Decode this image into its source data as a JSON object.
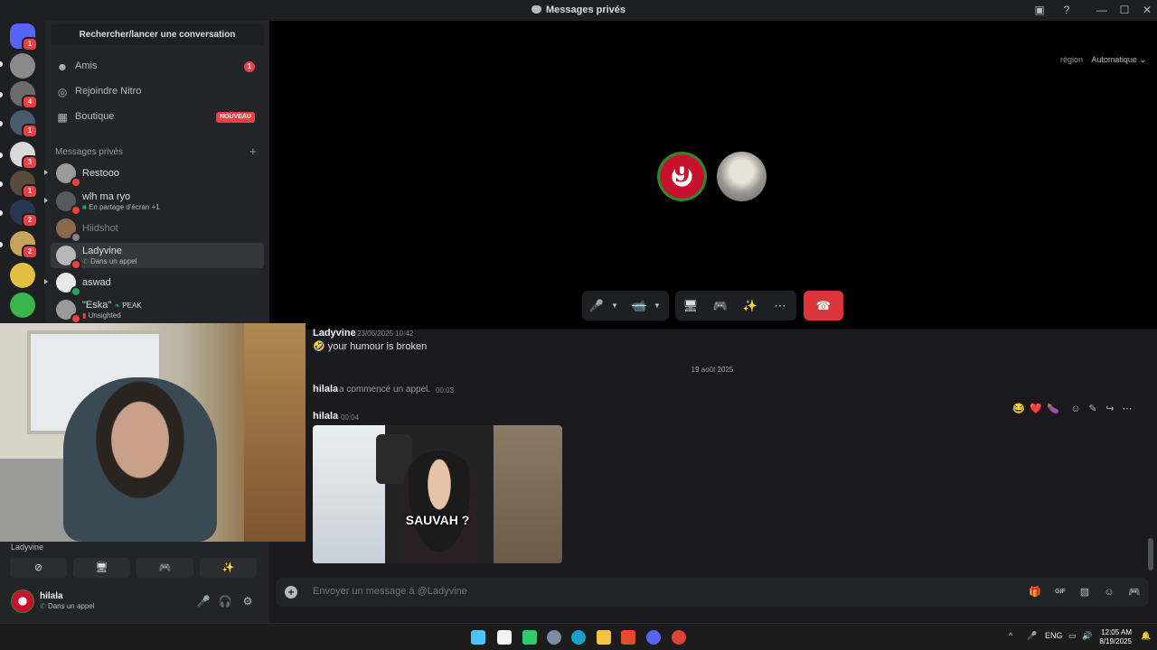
{
  "window": {
    "title": "Messages privés",
    "controls": {
      "minimize": "—",
      "maximize": "☐",
      "close": "✕"
    }
  },
  "servers": [
    {
      "name": "discord-home",
      "badge": "1",
      "color": "#5865f2"
    },
    {
      "name": "server-2",
      "badge": "",
      "color": "#8a8a8a"
    },
    {
      "name": "server-3",
      "badge": "4",
      "color": "#6b6b6b"
    },
    {
      "name": "server-4",
      "badge": "1",
      "color": "#4a5a6a"
    },
    {
      "name": "server-5",
      "badge": "3",
      "color": "#d9d9d9"
    },
    {
      "name": "server-6",
      "badge": "1",
      "color": "#5a4a3a"
    },
    {
      "name": "server-7",
      "badge": "2",
      "color": "#2a3550"
    },
    {
      "name": "server-8",
      "badge": "2",
      "color": "#c9a35a"
    },
    {
      "name": "server-9",
      "badge": "",
      "color": "#e0c040"
    },
    {
      "name": "server-10",
      "badge": "",
      "color": "#3bb54a"
    }
  ],
  "sidebar": {
    "search_label": "Rechercher/lancer une conversation",
    "nav": [
      {
        "label": "Amis",
        "icon": "friends-icon",
        "count": "1"
      },
      {
        "label": "Rejoindre Nitro",
        "icon": "nitro-icon"
      },
      {
        "label": "Boutique",
        "icon": "shop-icon",
        "badge": "NOUVEAU"
      }
    ],
    "dm_header": "Messages privés",
    "dm_add": "+",
    "dms": [
      {
        "name": "Restooo",
        "sub": "",
        "status_color": "#f23f43",
        "avatar_color": "#9a9a9a"
      },
      {
        "name": "wlh ma ryo",
        "sub": "En partage d'écran +1",
        "status_color": "#f23f43",
        "avatar_color": "#555a60"
      },
      {
        "name": "Hiidshot",
        "sub": "",
        "status_color": "#80848e",
        "avatar_color": "#8a6a4a"
      },
      {
        "name": "Ladyvine",
        "sub": "Dans un appel",
        "status_color": "#f23f43",
        "avatar_color": "#b8b8b8"
      },
      {
        "name": "aswad",
        "sub": "",
        "status_color": "#23a55a",
        "avatar_color": "#e8e8e8"
      },
      {
        "name": "\"Eska\"",
        "tag": "PEAK",
        "sub": "Unsighted",
        "status_color": "#f23f43",
        "avatar_color": "#9a9a9a"
      }
    ]
  },
  "call": {
    "region_label": "région",
    "region_value": "Automatique",
    "participants": [
      {
        "name": "hilala",
        "avatar_color": "#c8102e"
      },
      {
        "name": "Ladyvine",
        "avatar_color": "#c9c9c9"
      }
    ],
    "controls": {
      "mic": "🎤",
      "camera": "📹",
      "share": "🖥",
      "activity": "🎮",
      "soundboard": "✨",
      "more": "⋯",
      "hangup": "☎"
    }
  },
  "chat": {
    "prev_author": "Ladyvine",
    "prev_time": "23/06/2025 10:42",
    "prev_text": "🤣 your humour is broken",
    "date_divider": "19 août 2025",
    "call_author": "hilala",
    "call_text": "a commencé un appel.",
    "call_time": "00:03",
    "msg_author": "hilala",
    "msg_time": "00:04",
    "gif_caption": "SAUVAH ?",
    "reactions": [
      "😂",
      "❤️",
      "🍆"
    ],
    "composer_placeholder": "Envoyer un message à @Ladyvine"
  },
  "voice_panel": {
    "channel_name": "Ladyvine",
    "user_name": "hilala",
    "user_status": "Dans un appel"
  },
  "taskbar": {
    "lang": "ENG",
    "time": "12:05 AM",
    "date": "8/19/2025"
  }
}
